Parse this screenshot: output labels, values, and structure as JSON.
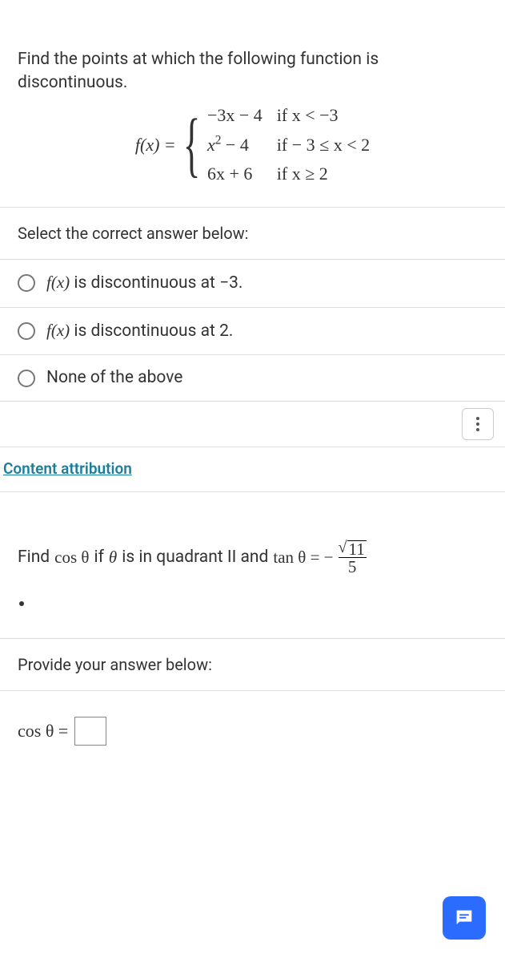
{
  "q1": {
    "stem": "Find the points at which the following function is discontinuous.",
    "fx_label": "f(x) =",
    "piece1_expr": "−3x − 4",
    "piece1_cond": "if x < −3",
    "piece2_expr_pre": "x",
    "piece2_expr_post": " − 4",
    "piece2_cond": "if − 3 ≤ x < 2",
    "piece3_expr": "6x + 6",
    "piece3_cond": "if x ≥ 2",
    "select_prompt": "Select the correct answer below:",
    "opt1_pre": "f(x)",
    "opt1_post": " is discontinuous at −3.",
    "opt2_pre": "f(x)",
    "opt2_post": " is discontinuous at 2.",
    "opt3": "None of the above"
  },
  "attribution": "Content attribution",
  "q2": {
    "stem_pre": "Find ",
    "cos": "cos θ",
    "stem_mid": " if ",
    "theta": "θ",
    "stem_post": " is in quadrant II and ",
    "tan": "tan θ = −",
    "sqrt_val": "11",
    "den": "5",
    "prompt": "Provide your answer below:",
    "ans_label": "cos θ ="
  }
}
